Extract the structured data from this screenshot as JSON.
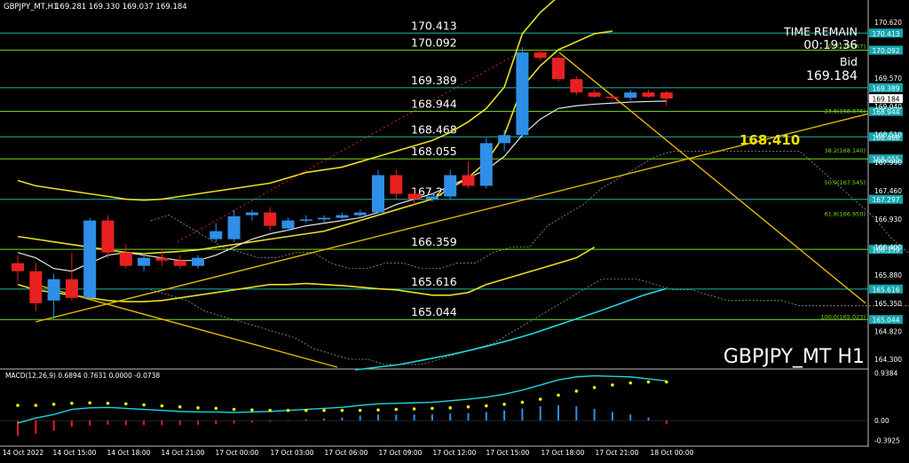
{
  "header": {
    "symbol_text": "GBPJPY_MT,H1",
    "ohlc_text": "169.281 169.330 169.037 169.184"
  },
  "watermark": "GBPJPY_MT H1",
  "time_remain": {
    "label": "TIME REMAIN",
    "value": "00:19:36"
  },
  "bid": {
    "label": "Bid",
    "value": "169.184"
  },
  "colors": {
    "background": "#000000",
    "bull": "#2e8fe6",
    "bear": "#e82020",
    "level_line": "#1fb5a8",
    "yellow_line": "#e8e020",
    "green_line": "#7ddc1f",
    "macd_line": "#1ed5e0",
    "macd_signal": "#f0f000",
    "trendline": "#e6b800",
    "axis_label_bg": "#14a6b0"
  },
  "chart_data": [
    {
      "type": "candlestick",
      "title": "GBPJPY_MT,H1",
      "ylim": [
        164.15,
        170.8
      ],
      "y_ticks": [
        "170.620",
        "169.570",
        "169.040",
        "168.510",
        "167.990",
        "167.460",
        "166.930",
        "166.400",
        "165.880",
        "165.350",
        "164.820",
        "164.300"
      ],
      "x_ticks": [
        "14 Oct 2022",
        "14 Oct 15:00",
        "14 Oct 18:00",
        "14 Oct 21:00",
        "17 Oct 00:00",
        "17 Oct 03:00",
        "17 Oct 06:00",
        "17 Oct 09:00",
        "17 Oct 12:00",
        "17 Oct 15:00",
        "17 Oct 18:00",
        "17 Oct 21:00",
        "18 Oct 00:00"
      ],
      "candles": [
        {
          "o": 166.1,
          "h": 166.25,
          "l": 165.75,
          "c": 165.95
        },
        {
          "o": 165.95,
          "h": 166.1,
          "l": 165.2,
          "c": 165.35
        },
        {
          "o": 165.4,
          "h": 165.9,
          "l": 165.05,
          "c": 165.8
        },
        {
          "o": 165.8,
          "h": 166.3,
          "l": 165.4,
          "c": 165.45
        },
        {
          "o": 165.45,
          "h": 166.95,
          "l": 165.4,
          "c": 166.9
        },
        {
          "o": 166.9,
          "h": 167.0,
          "l": 166.2,
          "c": 166.3
        },
        {
          "o": 166.3,
          "h": 166.45,
          "l": 166.0,
          "c": 166.05
        },
        {
          "o": 166.05,
          "h": 166.3,
          "l": 165.95,
          "c": 166.2
        },
        {
          "o": 166.2,
          "h": 166.35,
          "l": 166.05,
          "c": 166.15
        },
        {
          "o": 166.15,
          "h": 166.25,
          "l": 166.0,
          "c": 166.05
        },
        {
          "o": 166.05,
          "h": 166.25,
          "l": 166.0,
          "c": 166.2
        },
        {
          "o": 166.55,
          "h": 166.85,
          "l": 166.5,
          "c": 166.7
        },
        {
          "o": 166.55,
          "h": 167.1,
          "l": 166.5,
          "c": 166.98
        },
        {
          "o": 167.0,
          "h": 167.1,
          "l": 166.9,
          "c": 167.05
        },
        {
          "o": 167.05,
          "h": 167.15,
          "l": 166.7,
          "c": 166.8
        },
        {
          "o": 166.75,
          "h": 166.95,
          "l": 166.7,
          "c": 166.9
        },
        {
          "o": 166.9,
          "h": 167.0,
          "l": 166.85,
          "c": 166.92
        },
        {
          "o": 166.92,
          "h": 167.0,
          "l": 166.85,
          "c": 166.95
        },
        {
          "o": 166.95,
          "h": 167.05,
          "l": 166.9,
          "c": 167.0
        },
        {
          "o": 167.0,
          "h": 167.1,
          "l": 166.95,
          "c": 167.05
        },
        {
          "o": 167.05,
          "h": 167.85,
          "l": 167.0,
          "c": 167.75
        },
        {
          "o": 167.75,
          "h": 167.85,
          "l": 167.3,
          "c": 167.4
        },
        {
          "o": 167.4,
          "h": 167.5,
          "l": 167.2,
          "c": 167.3
        },
        {
          "o": 167.3,
          "h": 167.4,
          "l": 167.25,
          "c": 167.35
        },
        {
          "o": 167.35,
          "h": 167.85,
          "l": 167.3,
          "c": 167.75
        },
        {
          "o": 167.75,
          "h": 168.0,
          "l": 167.5,
          "c": 167.55
        },
        {
          "o": 167.55,
          "h": 168.45,
          "l": 167.5,
          "c": 168.35
        },
        {
          "o": 168.35,
          "h": 168.6,
          "l": 168.2,
          "c": 168.5
        },
        {
          "o": 168.5,
          "h": 170.15,
          "l": 168.45,
          "c": 170.05
        },
        {
          "o": 170.05,
          "h": 170.1,
          "l": 169.9,
          "c": 169.95
        },
        {
          "o": 169.95,
          "h": 170.0,
          "l": 169.5,
          "c": 169.55
        },
        {
          "o": 169.55,
          "h": 169.6,
          "l": 169.25,
          "c": 169.3
        },
        {
          "o": 169.3,
          "h": 169.35,
          "l": 169.2,
          "c": 169.22
        },
        {
          "o": 169.22,
          "h": 169.28,
          "l": 169.15,
          "c": 169.2
        },
        {
          "o": 169.2,
          "h": 169.35,
          "l": 169.15,
          "c": 169.3
        },
        {
          "o": 169.3,
          "h": 169.35,
          "l": 169.2,
          "c": 169.22
        },
        {
          "o": 169.3,
          "h": 169.33,
          "l": 169.04,
          "c": 169.184
        }
      ],
      "levels": [
        {
          "value": 170.413,
          "label": "170.413",
          "color": "#1fb5a8"
        },
        {
          "value": 170.092,
          "label": "170.092",
          "color": "#7ddc1f"
        },
        {
          "value": 169.389,
          "label": "169.389",
          "color": "#1fb5a8"
        },
        {
          "value": 168.944,
          "label": "168.944",
          "color": "#7ddc1f"
        },
        {
          "value": 168.468,
          "label": "168.468",
          "color": "#1fb5a8"
        },
        {
          "value": 168.055,
          "label": "168.055",
          "color": "#7ddc1f"
        },
        {
          "value": 167.297,
          "label": "167.297",
          "color": "#1fb5a8"
        },
        {
          "value": 166.359,
          "label": "166.359",
          "color": "#7ddc1f"
        },
        {
          "value": 165.616,
          "label": "165.616",
          "color": "#1fb5a8"
        },
        {
          "value": 165.044,
          "label": "165.044",
          "color": "#7ddc1f"
        }
      ],
      "fibonacci": [
        {
          "value": 170.092,
          "label": "0.0(170.067)"
        },
        {
          "value": 168.876,
          "label": "23.6(168.876)"
        },
        {
          "value": 168.14,
          "label": "38.2(168.140)"
        },
        {
          "value": 167.545,
          "label": "50.0(167.545)"
        },
        {
          "value": 166.95,
          "label": "61.8(166.950)"
        },
        {
          "value": 165.023,
          "label": "100.0(165.023)"
        }
      ],
      "highlight_level": "168.410",
      "current_price": "169.184"
    },
    {
      "type": "bar",
      "title": "MACD(12,26,9) 0.6894 0.7631 0.0000 -0.0738",
      "ylim": [
        -0.45,
        0.98
      ],
      "y_ticks": [
        "0.9384",
        "0.00",
        "-0.3925"
      ],
      "macd_line": [
        -0.05,
        0.05,
        0.12,
        0.22,
        0.25,
        0.26,
        0.24,
        0.22,
        0.2,
        0.18,
        0.17,
        0.17,
        0.16,
        0.17,
        0.18,
        0.2,
        0.22,
        0.24,
        0.26,
        0.3,
        0.33,
        0.34,
        0.35,
        0.36,
        0.39,
        0.42,
        0.46,
        0.52,
        0.6,
        0.7,
        0.8,
        0.86,
        0.88,
        0.87,
        0.86,
        0.82,
        0.78
      ],
      "signal": [
        0.3,
        0.3,
        0.32,
        0.34,
        0.35,
        0.34,
        0.33,
        0.31,
        0.29,
        0.27,
        0.25,
        0.24,
        0.22,
        0.21,
        0.2,
        0.2,
        0.2,
        0.2,
        0.2,
        0.2,
        0.21,
        0.22,
        0.23,
        0.24,
        0.25,
        0.27,
        0.29,
        0.32,
        0.36,
        0.42,
        0.5,
        0.58,
        0.65,
        0.7,
        0.74,
        0.76,
        0.76
      ],
      "histogram": [
        -0.3,
        -0.26,
        -0.2,
        -0.12,
        -0.1,
        -0.08,
        -0.09,
        -0.09,
        -0.09,
        -0.09,
        -0.08,
        -0.07,
        -0.06,
        -0.04,
        -0.02,
        0.0,
        0.02,
        0.04,
        0.06,
        0.1,
        0.12,
        0.12,
        0.12,
        0.12,
        0.14,
        0.15,
        0.17,
        0.2,
        0.24,
        0.28,
        0.3,
        0.28,
        0.23,
        0.17,
        0.12,
        0.06,
        -0.07
      ]
    }
  ]
}
